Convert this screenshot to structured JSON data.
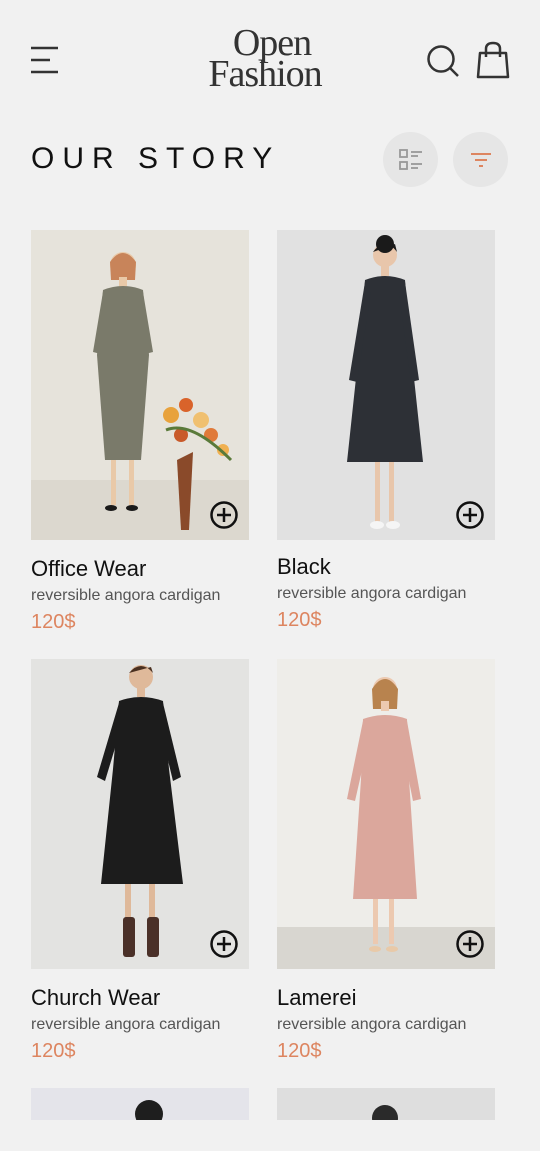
{
  "header": {
    "logo_line1": "Open",
    "logo_line2": "Fashion",
    "icons": [
      "menu-icon",
      "search-icon",
      "shopping-bag-icon"
    ]
  },
  "section": {
    "title": "OUR STORY",
    "view_icon": "list-view-icon",
    "filter_icon": "filter-icon"
  },
  "colors": {
    "background": "#f1f1f1",
    "price": "#dd8560",
    "accent_filter": "#dd8560"
  },
  "products": [
    {
      "name": "Office Wear",
      "description": "reversible angora cardigan",
      "price": "120$",
      "dress_color": "#7a7a6a"
    },
    {
      "name": "Black",
      "description": "reversible angora cardigan",
      "price": "120$",
      "dress_color": "#2d3036"
    },
    {
      "name": "Church Wear",
      "description": "reversible angora cardigan",
      "price": "120$",
      "dress_color": "#1c1c1c"
    },
    {
      "name": "Lamerei",
      "description": "reversible angora cardigan",
      "price": "120$",
      "dress_color": "#dba79c"
    }
  ]
}
